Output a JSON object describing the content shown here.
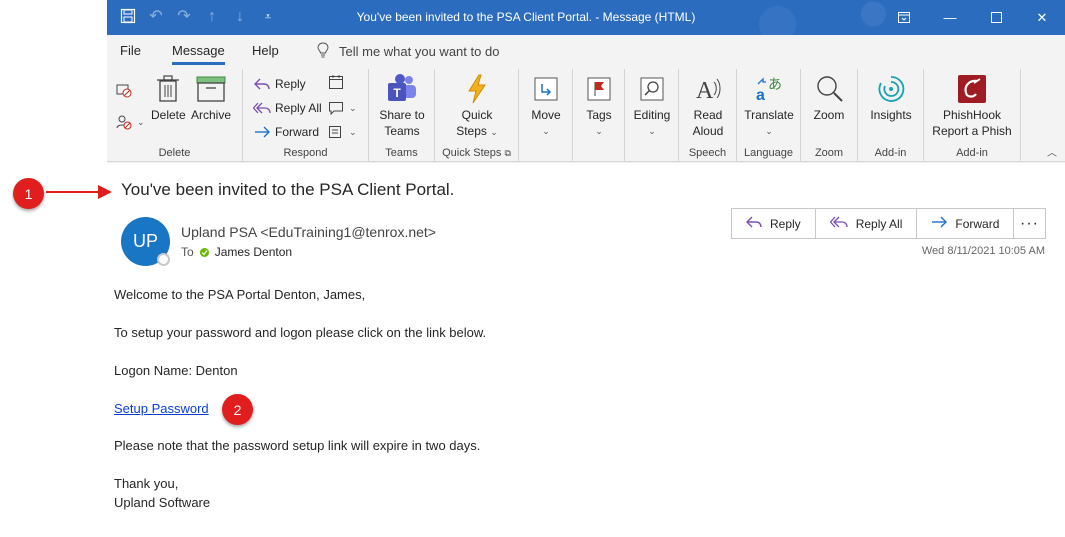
{
  "window": {
    "title": "You've been invited to the PSA Client Portal.  -  Message (HTML)"
  },
  "menu": {
    "file": "File",
    "message": "Message",
    "help": "Help",
    "tell_me": "Tell me what you want to do"
  },
  "ribbon": {
    "delete_group": {
      "label": "Delete",
      "delete": "Delete",
      "archive": "Archive"
    },
    "respond_group": {
      "label": "Respond",
      "reply": "Reply",
      "reply_all": "Reply All",
      "forward": "Forward"
    },
    "teams_group": {
      "label": "Teams",
      "share_line1": "Share to",
      "share_line2": "Teams"
    },
    "quicksteps_group": {
      "label": "Quick Steps",
      "line1": "Quick",
      "line2": "Steps"
    },
    "move_group": {
      "move": "Move"
    },
    "tags_group": {
      "tags": "Tags"
    },
    "editing_group": {
      "editing": "Editing"
    },
    "speech_group": {
      "label": "Speech",
      "line1": "Read",
      "line2": "Aloud"
    },
    "language_group": {
      "label": "Language",
      "translate": "Translate"
    },
    "zoom_group": {
      "label": "Zoom",
      "zoom": "Zoom"
    },
    "addin_group1": {
      "label": "Add-in",
      "insights": "Insights"
    },
    "addin_group2": {
      "label": "Add-in",
      "line1": "PhishHook",
      "line2": "Report a Phish"
    }
  },
  "message": {
    "subject": "You've been invited to the PSA Client Portal.",
    "avatar_initials": "UP",
    "sender": "Upland PSA <EduTraining1@tenrox.net>",
    "to_label": "To",
    "recipient": "James Denton",
    "date": "Wed 8/11/2021 10:05 AM",
    "actions": {
      "reply": "Reply",
      "reply_all": "Reply All",
      "forward": "Forward",
      "more": "···"
    }
  },
  "body": {
    "greeting": "Welcome to the PSA Portal Denton, James,",
    "instruction": "To setup your password and logon please click on the link below.",
    "logon": "Logon Name: Denton",
    "link": "Setup Password",
    "note": "Please note that the password setup link will expire in two days.",
    "closing": "Thank you,",
    "signature": "Upland Software"
  },
  "annotations": {
    "badge1": "1",
    "badge2": "2"
  },
  "colors": {
    "titlebar": "#2b6cbf",
    "avatar": "#1976c5",
    "badge": "#e01e1e",
    "link": "#0b3fd1"
  }
}
